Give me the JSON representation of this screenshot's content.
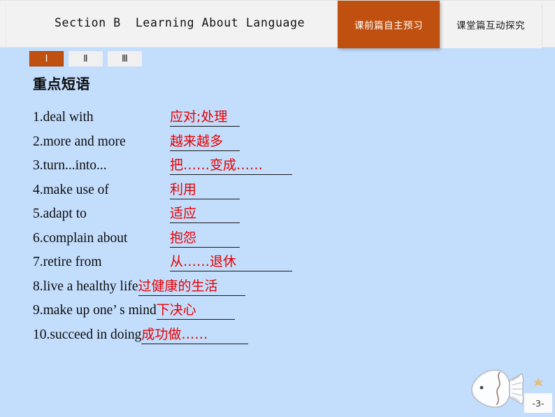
{
  "header": {
    "title": "Section B  Learning About Language",
    "tabs": [
      {
        "label": "课前篇自主预习",
        "active": true
      },
      {
        "label": "课堂篇互动探究",
        "active": false
      }
    ]
  },
  "roman_tabs": [
    {
      "label": "Ⅰ",
      "active": true
    },
    {
      "label": "Ⅱ",
      "active": false
    },
    {
      "label": "Ⅲ",
      "active": false
    }
  ],
  "main": {
    "section_title": "重点短语",
    "phrases": [
      {
        "num": "1.",
        "en": "deal with",
        "cn": "应对;处理"
      },
      {
        "num": "2.",
        "en": "more and more",
        "cn": "越来越多"
      },
      {
        "num": "3.",
        "en": "turn...into...",
        "cn": "把……变成……"
      },
      {
        "num": "4.",
        "en": "make use of",
        "cn": "利用"
      },
      {
        "num": "5.",
        "en": "adapt to",
        "cn": "适应"
      },
      {
        "num": "6.",
        "en": "complain about",
        "cn": "抱怨"
      },
      {
        "num": "7.",
        "en": "retire from",
        "cn": "从……退休"
      },
      {
        "num": "8.",
        "en": "live a healthy life",
        "cn": "过健康的生活"
      },
      {
        "num": "9.",
        "en": "make up one’ s mind",
        "cn": "下决心"
      },
      {
        "num": "10.",
        "en": "succeed in doing",
        "cn": "成功做……"
      }
    ]
  },
  "footer": {
    "page_number": "-3-"
  },
  "colors": {
    "background": "#c3ddfc",
    "accent": "#c0500f",
    "answer_red": "#e60000",
    "header_bg": "#f2f2f2"
  }
}
